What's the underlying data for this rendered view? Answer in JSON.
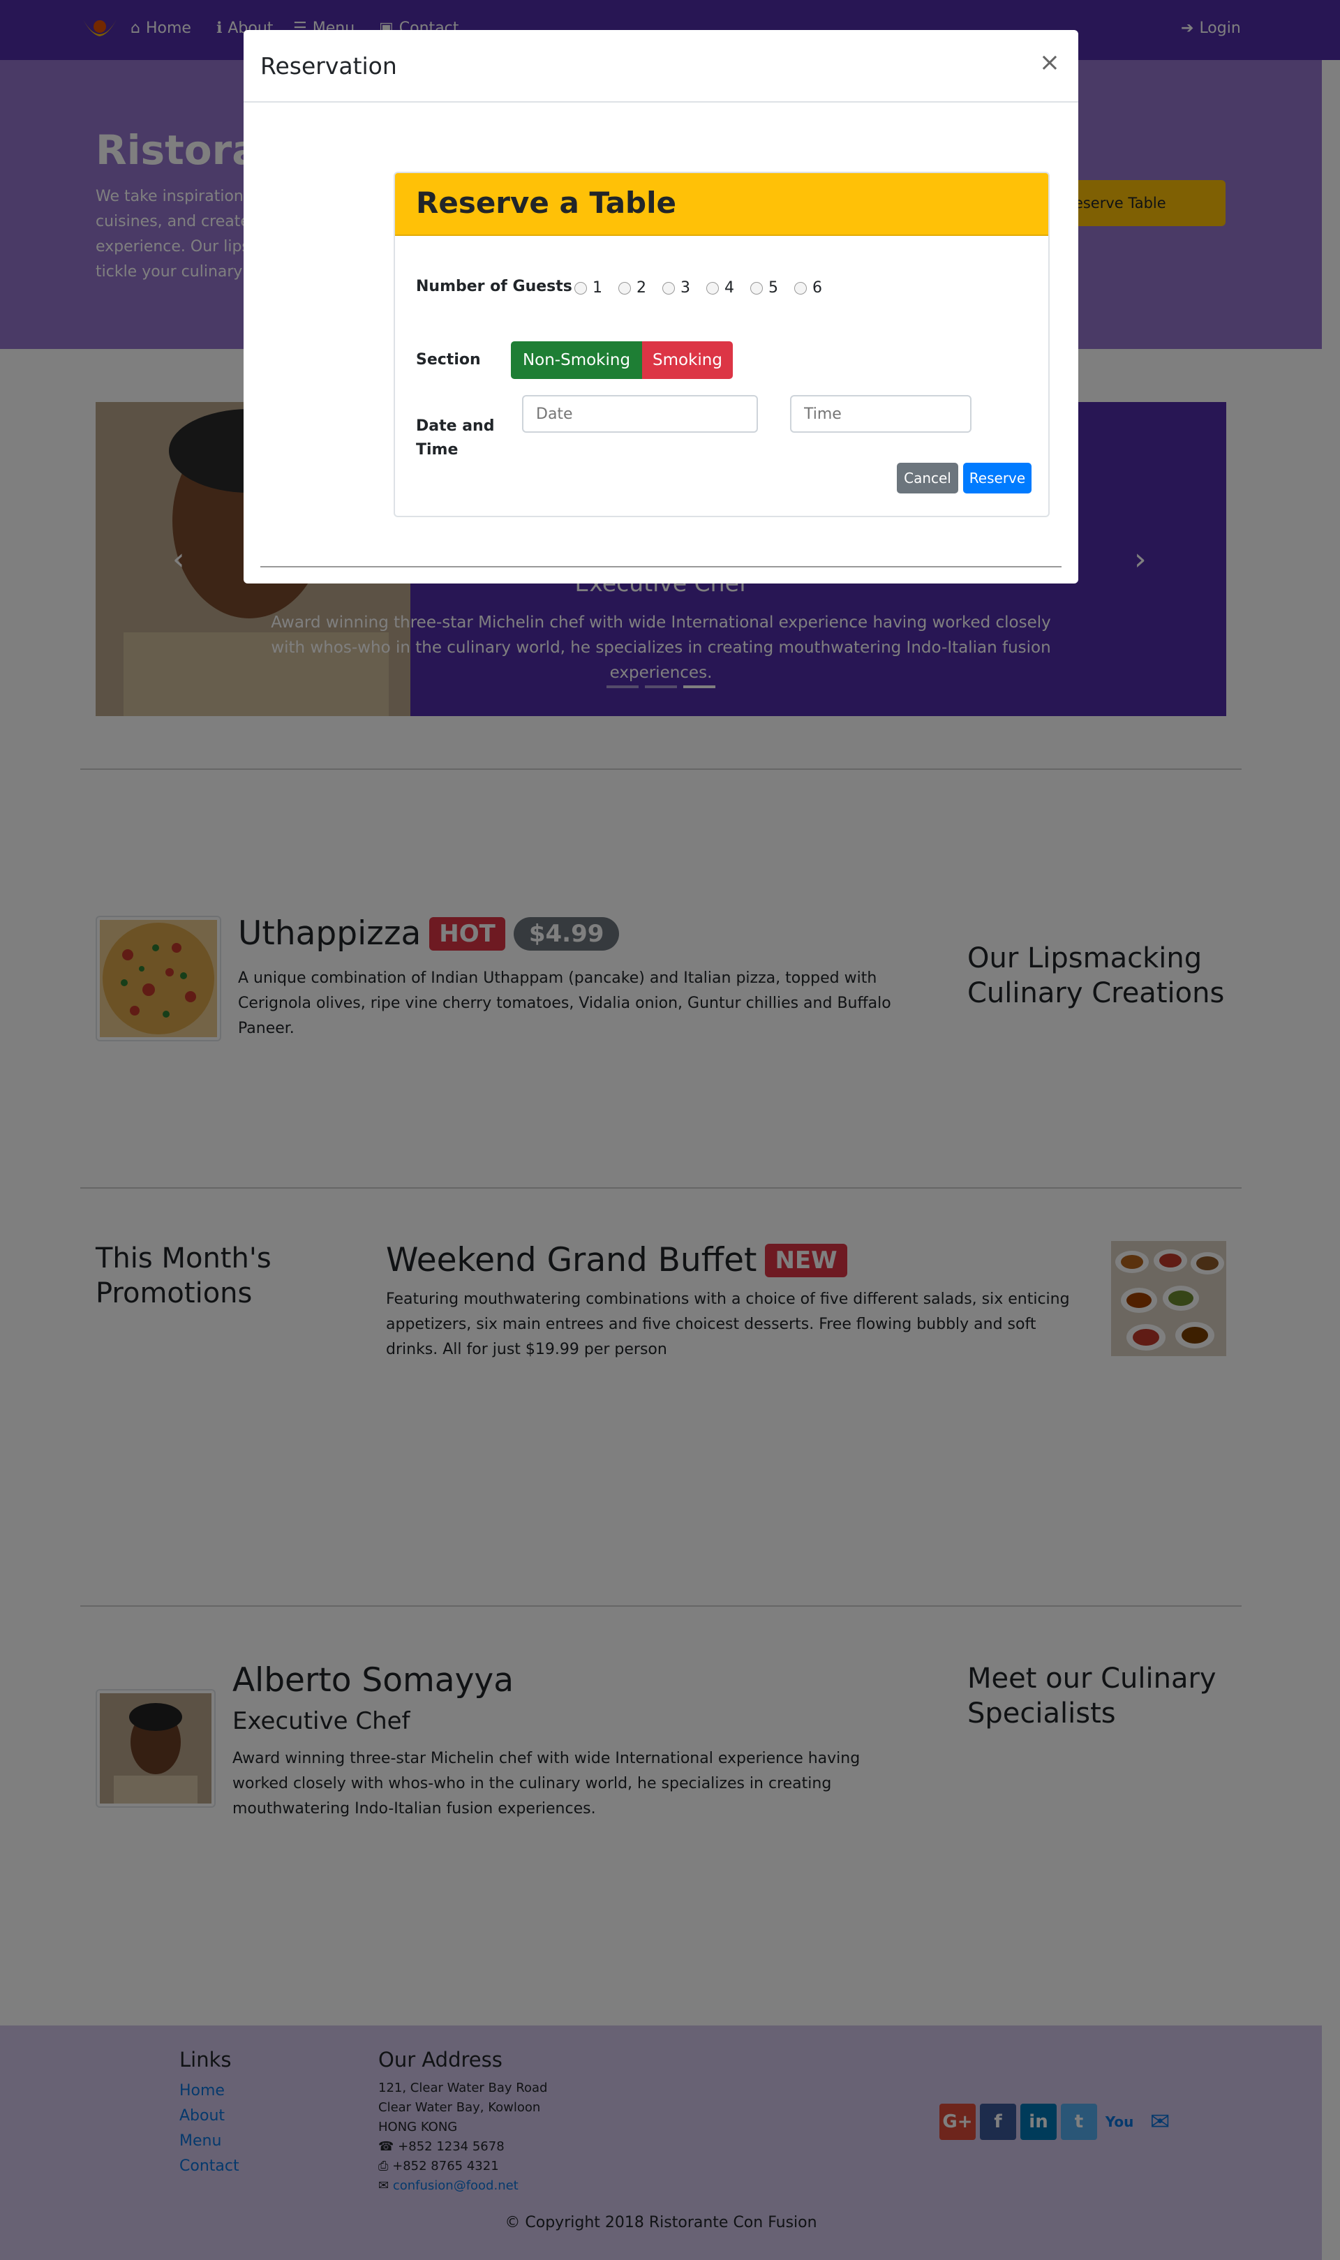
{
  "navbar": {
    "items": [
      {
        "label": "Home"
      },
      {
        "label": "About"
      },
      {
        "label": "Menu"
      },
      {
        "label": "Contact"
      }
    ],
    "login": "Login"
  },
  "jumbotron": {
    "title": "Ristorante con Fusion",
    "text": "We take inspiration from the World's best cuisines, and create a unique fusion experience. Our lipsmacking creations will tickle your culinary senses!",
    "button": "Reserve Table"
  },
  "carousel": {
    "name": "Alberto Somayya",
    "caption_title": "Executive Chef",
    "caption_text": "Award winning three-star Michelin chef with wide International experience having worked closely with whos-who in the culinary world, he specializes in creating mouthwatering Indo-Italian fusion experiences.",
    "active_indicator": 3
  },
  "dish": {
    "name": "Uthappizza",
    "label": "HOT",
    "price": "$4.99",
    "description": "A unique combination of Indian Uthappam (pancake) and Italian pizza, topped with Cerignola olives, ripe vine cherry tomatoes, Vidalia onion, Guntur chillies and Buffalo Paneer.",
    "side_heading": "Our Lipsmacking Culinary Creations"
  },
  "promotion": {
    "side_heading": "This Month's Promotions",
    "name": "Weekend Grand Buffet",
    "label": "NEW",
    "description": "Featuring mouthwatering combinations with a choice of five different salads, six enticing appetizers, six main entrees and five choicest desserts. Free flowing bubbly and soft drinks. All for just $19.99 per person"
  },
  "leader": {
    "name": "Alberto Somayya",
    "designation": "Executive Chef",
    "description": "Award winning three-star Michelin chef with wide International experience having worked closely with whos-who in the culinary world, he specializes in creating mouthwatering Indo-Italian fusion experiences.",
    "side_heading": "Meet our Culinary Specialists"
  },
  "footer": {
    "links_heading": "Links",
    "links": [
      "Home",
      "About",
      "Menu",
      "Contact"
    ],
    "address_heading": "Our Address",
    "address_lines": [
      "121, Clear Water Bay Road",
      "Clear Water Bay, Kowloon",
      "HONG KONG"
    ],
    "phone": "+852 1234 5678",
    "fax": "+852 8765 4321",
    "email": "confusion@food.net",
    "copyright": "© Copyright 2018 Ristorante Con Fusion"
  },
  "modal": {
    "title": "Reservation",
    "close": "×",
    "card_title": "Reserve a Table",
    "guests_label": "Number of Guests",
    "guest_options": [
      "1",
      "2",
      "3",
      "4",
      "5",
      "6"
    ],
    "section_label": "Section",
    "section_options": [
      "Non-Smoking",
      "Smoking"
    ],
    "datetime_label_1": "Date and",
    "datetime_label_2": "Time",
    "date_placeholder": "Date",
    "time_placeholder": "Time",
    "cancel": "Cancel",
    "reserve": "Reserve"
  },
  "colors": {
    "primary": "#512DA8",
    "jumbotron": "#9575CD",
    "footer": "#D1C4E9",
    "warning": "#FFC107",
    "success": "#1E7E34",
    "danger": "#DC3545",
    "btn_primary": "#007BFF",
    "btn_secondary": "#6C757D"
  },
  "icons": [
    "logo",
    "home-icon",
    "info-icon",
    "list-icon",
    "address-card-icon",
    "sign-in-icon",
    "phone-icon",
    "fax-icon",
    "envelope-icon",
    "google-plus-icon",
    "facebook-icon",
    "linkedin-icon",
    "twitter-icon",
    "youtube-icon",
    "mail-icon"
  ]
}
